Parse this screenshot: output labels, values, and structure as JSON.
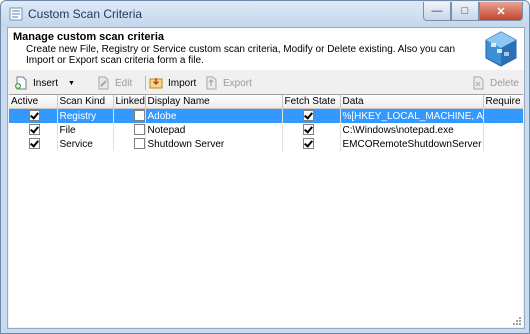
{
  "window": {
    "title": "Custom Scan Criteria"
  },
  "header": {
    "title": "Manage custom scan criteria",
    "description": "Create new File, Registry or Service custom scan criteria, Modify or Delete existing. Also you can Import or Export scan criteria form a file."
  },
  "toolbar": {
    "insert": "Insert",
    "edit": "Edit",
    "import": "Import",
    "export": "Export",
    "delete": "Delete"
  },
  "grid": {
    "columns": [
      "Active",
      "Scan Kind",
      "Linked",
      "Display Name",
      "Fetch State",
      "Data",
      "Require R"
    ],
    "rows": [
      {
        "active": true,
        "kind": "Registry",
        "linked": false,
        "name": "Adobe",
        "fetch": true,
        "data": "%[HKEY_LOCAL_MACHINE, Adobe, ",
        "selected": true
      },
      {
        "active": true,
        "kind": "File",
        "linked": false,
        "name": "Notepad",
        "fetch": true,
        "data": "C:\\Windows\\notepad.exe",
        "selected": false
      },
      {
        "active": true,
        "kind": "Service",
        "linked": false,
        "name": "Shutdown Server",
        "fetch": true,
        "data": "EMCORemoteShutdownServer",
        "selected": false
      }
    ]
  },
  "colors": {
    "selection": "#3399ff",
    "title_text": "#1e395b",
    "frame": "#c9dbee"
  },
  "icons": [
    "scan-criteria-icon",
    "minimize-icon",
    "maximize-icon",
    "close-icon",
    "app-logo-icon",
    "insert-icon",
    "edit-icon",
    "import-icon",
    "export-icon",
    "delete-icon",
    "checkbox-icon"
  ]
}
